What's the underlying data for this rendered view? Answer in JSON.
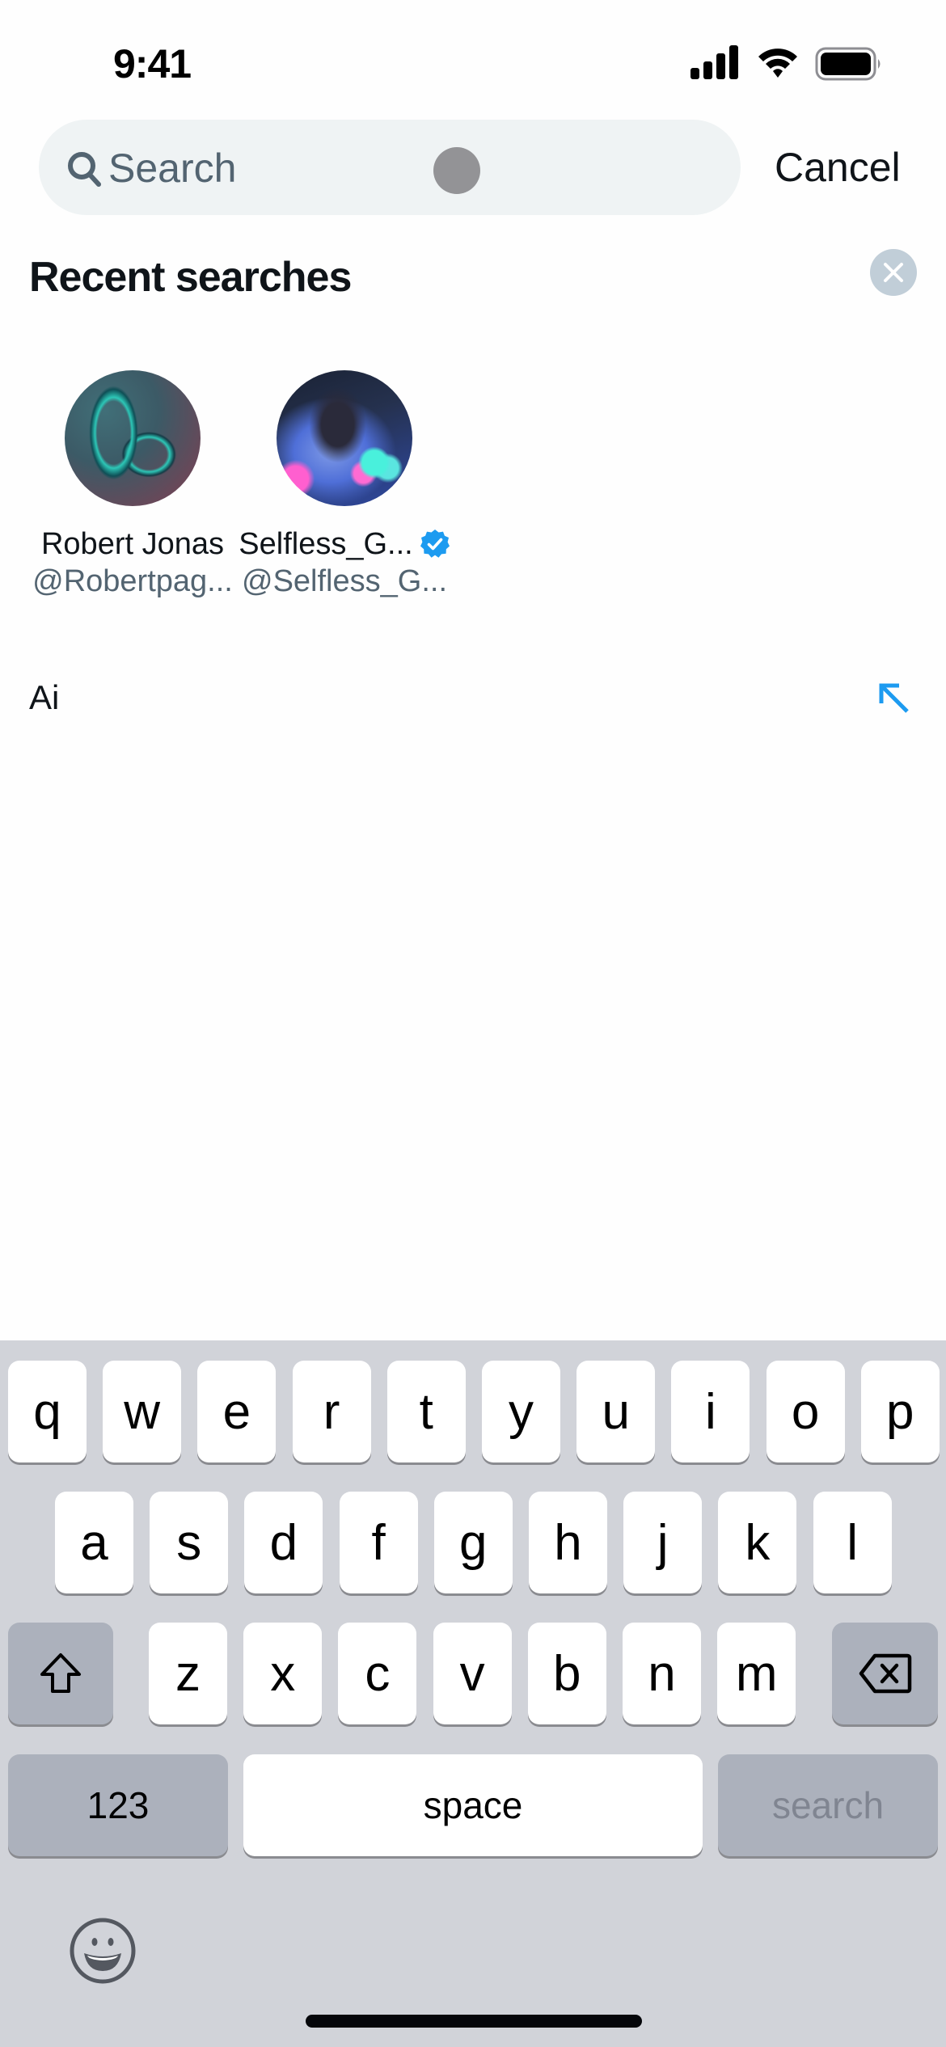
{
  "status_bar": {
    "time": "9:41",
    "icons": [
      "cellular-signal-icon",
      "wifi-icon",
      "battery-icon"
    ]
  },
  "search": {
    "placeholder": "Search",
    "value": "",
    "cancel_label": "Cancel"
  },
  "recent": {
    "title": "Recent searches",
    "clear_icon": "close-icon",
    "users": [
      {
        "name": "Robert Jonas",
        "handle": "@Robertpag...",
        "verified": false
      },
      {
        "name": "Selfless_G...",
        "handle": "@Selfless_G...",
        "verified": true
      }
    ],
    "queries": [
      {
        "text": "Ai",
        "action_icon": "arrow-up-left-icon"
      }
    ]
  },
  "keyboard": {
    "rows": [
      [
        "q",
        "w",
        "e",
        "r",
        "t",
        "y",
        "u",
        "i",
        "o",
        "p"
      ],
      [
        "a",
        "s",
        "d",
        "f",
        "g",
        "h",
        "j",
        "k",
        "l"
      ],
      [
        "z",
        "x",
        "c",
        "v",
        "b",
        "n",
        "m"
      ]
    ],
    "shift_icon": "shift-icon",
    "delete_icon": "delete-backward-icon",
    "numbers_label": "123",
    "space_label": "space",
    "return_label": "search",
    "return_enabled": false,
    "emoji_icon": "emoji-icon"
  },
  "colors": {
    "accent": "#1d9bf0",
    "verified": "#1d9bf0",
    "secondary_text": "#536471",
    "search_bg": "#eff3f4",
    "keyboard_bg": "#d1d3d9"
  }
}
